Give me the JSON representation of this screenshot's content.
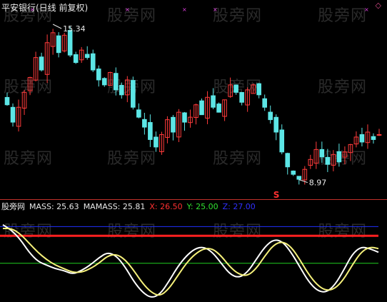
{
  "title": "平安银行(日线 前复权)",
  "watermark": "股旁网",
  "diamond_icon": "diamond-icon",
  "price_chart": {
    "type": "candlestick",
    "high_label": "15.34",
    "low_label": "8.97",
    "signal_marker": "S",
    "up_color": "#ff3b3b",
    "down_color": "#5ce6e6",
    "marker_color": "#e040e0",
    "ohlc_closes": [
      12.1,
      11.4,
      12.0,
      12.6,
      13.2,
      14.0,
      13.5,
      14.6,
      15.0,
      14.2,
      14.9,
      14.1,
      13.8,
      14.3,
      14.0,
      13.5,
      13.1,
      12.9,
      13.4,
      12.7,
      12.5,
      13.1,
      12.0,
      11.6,
      11.2,
      10.7,
      10.4,
      10.9,
      11.5,
      11.0,
      11.8,
      11.4,
      11.6,
      12.1,
      11.7,
      12.4,
      12.0,
      11.8,
      12.3,
      12.9,
      12.6,
      12.2,
      12.7,
      12.9,
      12.5,
      12.0,
      11.5,
      11.0,
      10.2,
      9.6,
      9.3,
      9.1,
      9.5,
      9.9,
      10.3,
      10.0,
      9.7,
      10.1,
      9.8,
      10.2,
      10.5,
      10.8,
      10.6,
      11.0,
      10.7,
      10.9
    ],
    "ylim": [
      8.5,
      15.8
    ]
  },
  "indicator": {
    "name": "MASS",
    "legend": [
      {
        "label": "股旁网",
        "color": "#e8e8e8"
      },
      {
        "label": "MASS: 25.63",
        "color": "#e8e8e8"
      },
      {
        "label": "MAMASS: 25.81",
        "color": "#e8e8e8"
      },
      {
        "label": "X: 26.50",
        "color": "#ff3030"
      },
      {
        "label": "Y: 25.00",
        "color": "#30e030"
      },
      {
        "label": "Z: 27.00",
        "color": "#3030ff"
      }
    ],
    "x_level": 26.5,
    "y_level": 25.0,
    "z_level": 27.0,
    "mass_color": "#ffffff",
    "mamass_color": "#f5f07a",
    "ylim": [
      23.0,
      27.6
    ]
  },
  "chart_data": [
    {
      "type": "line",
      "title": "平安银行(日线 前复权)",
      "series": [],
      "annotations": [
        "15.34",
        "8.97",
        "S"
      ]
    },
    {
      "type": "line",
      "series": [
        {
          "name": "MASS",
          "values": [
            27.1,
            26.8,
            26.3,
            25.6,
            25.1,
            24.9,
            24.7,
            24.6,
            24.4,
            24.6,
            24.9,
            25.3,
            25.6,
            25.4,
            24.8,
            24.0,
            23.4,
            23.1,
            23.3,
            24.0,
            24.8,
            25.4,
            25.8,
            25.9,
            25.6,
            25.0,
            24.4,
            24.2,
            24.5,
            25.2,
            25.9,
            26.3,
            26.2,
            25.6,
            24.8,
            24.0,
            23.5,
            23.4,
            23.8,
            24.6,
            25.5,
            25.9,
            25.8,
            25.6
          ]
        },
        {
          "name": "MAMASS",
          "values": [
            26.9,
            26.9,
            26.6,
            26.1,
            25.6,
            25.2,
            24.9,
            24.7,
            24.5,
            24.5,
            24.7,
            25.0,
            25.4,
            25.5,
            25.2,
            24.6,
            23.9,
            23.4,
            23.2,
            23.6,
            24.3,
            25.0,
            25.5,
            25.8,
            25.8,
            25.4,
            24.8,
            24.4,
            24.3,
            24.7,
            25.4,
            26.0,
            26.2,
            25.9,
            25.2,
            24.4,
            23.8,
            23.5,
            23.6,
            24.1,
            24.9,
            25.6,
            25.9,
            25.8
          ]
        }
      ],
      "hlines": [
        {
          "name": "X",
          "value": 26.5
        },
        {
          "name": "Y",
          "value": 25.0
        },
        {
          "name": "Z",
          "value": 27.0
        }
      ]
    }
  ]
}
